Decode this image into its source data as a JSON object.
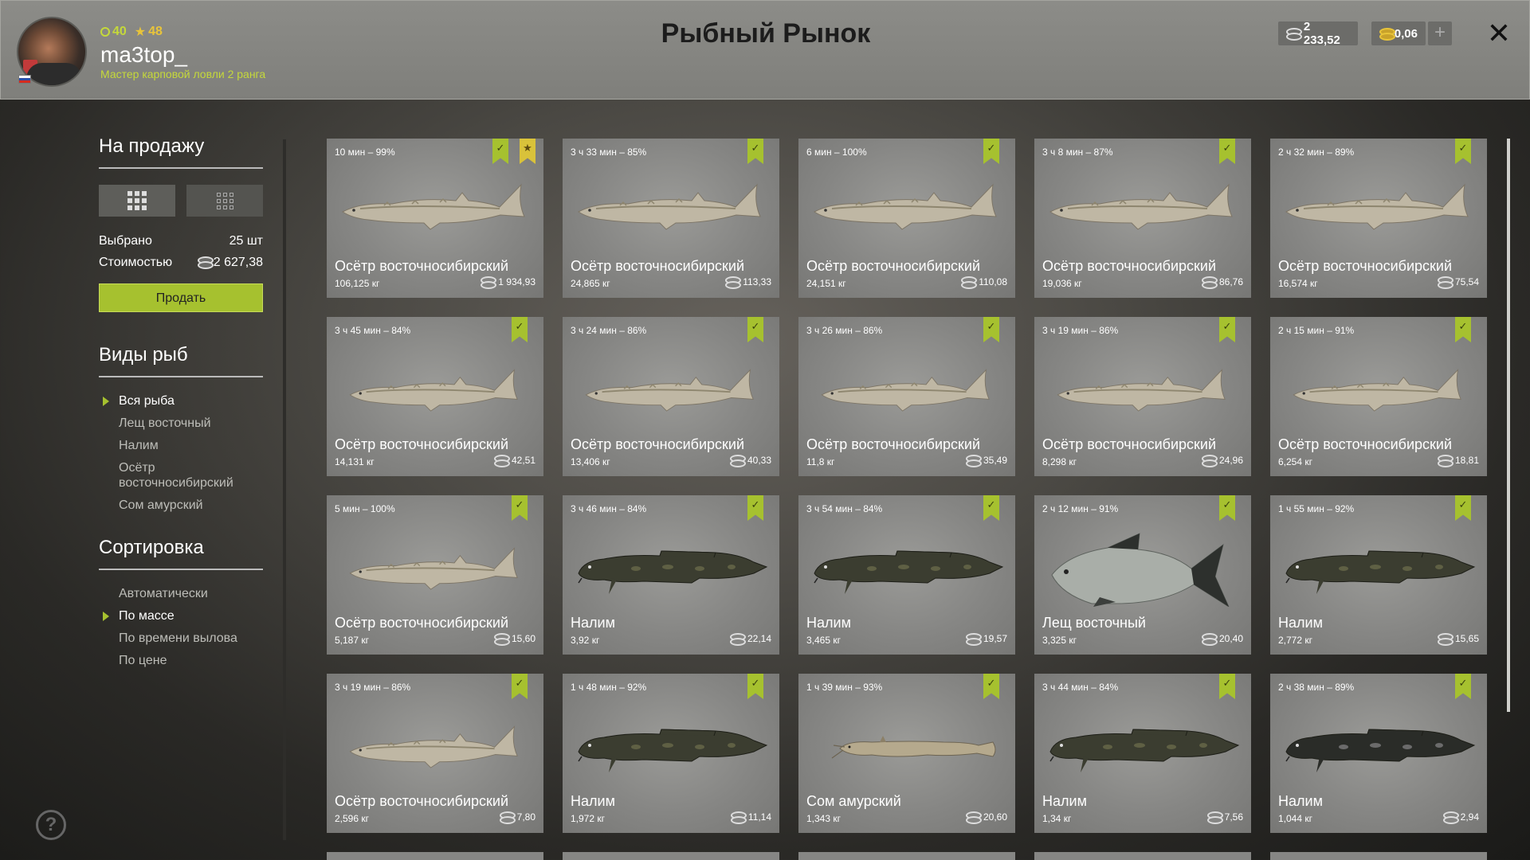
{
  "header": {
    "title": "Рыбный Рынок",
    "username": "ma3top_",
    "rank": "Мастер карповой ловли 2 ранга",
    "level": "40",
    "stars": "48",
    "silver": "2 233,52",
    "gold": "0,06",
    "add_label": "+",
    "close_label": "✕"
  },
  "sidebar": {
    "for_sale_title": "На продажу",
    "selected_label": "Выбрано",
    "selected_value": "25 шт",
    "cost_label": "Стоимостью",
    "cost_value": "2 627,38",
    "sell_label": "Продать",
    "species_title": "Виды рыб",
    "species": [
      {
        "label": "Вся рыба",
        "active": true
      },
      {
        "label": "Лещ восточный",
        "active": false
      },
      {
        "label": "Налим",
        "active": false
      },
      {
        "label": "Осётр восточносибирский",
        "active": false
      },
      {
        "label": "Сом амурский",
        "active": false
      }
    ],
    "sort_title": "Сортировка",
    "sorts": [
      {
        "label": "Автоматически",
        "active": false
      },
      {
        "label": "По массе",
        "active": true
      },
      {
        "label": "По времени вылова",
        "active": false
      },
      {
        "label": "По цене",
        "active": false
      }
    ],
    "help_label": "?"
  },
  "fish_cards": [
    {
      "time": "10 мин – 99%",
      "name": "Осётр восточносибирский",
      "weight": "106,125 кг",
      "price": "1 934,93",
      "type": "sturgeon",
      "starred": true
    },
    {
      "time": "3 ч 33 мин – 85%",
      "name": "Осётр восточносибирский",
      "weight": "24,865 кг",
      "price": "113,33",
      "type": "sturgeon",
      "starred": false
    },
    {
      "time": "6 мин – 100%",
      "name": "Осётр восточносибирский",
      "weight": "24,151 кг",
      "price": "110,08",
      "type": "sturgeon",
      "starred": false
    },
    {
      "time": "3 ч 8 мин – 87%",
      "name": "Осётр восточносибирский",
      "weight": "19,036 кг",
      "price": "86,76",
      "type": "sturgeon",
      "starred": false
    },
    {
      "time": "2 ч 32 мин – 89%",
      "name": "Осётр восточносибирский",
      "weight": "16,574 кг",
      "price": "75,54",
      "type": "sturgeon",
      "starred": false
    },
    {
      "time": "3 ч 45 мин – 84%",
      "name": "Осётр восточносибирский",
      "weight": "14,131 кг",
      "price": "42,51",
      "type": "sturgeon-small",
      "starred": false
    },
    {
      "time": "3 ч 24 мин – 86%",
      "name": "Осётр восточносибирский",
      "weight": "13,406 кг",
      "price": "40,33",
      "type": "sturgeon-small",
      "starred": false
    },
    {
      "time": "3 ч 26 мин – 86%",
      "name": "Осётр восточносибирский",
      "weight": "11,8 кг",
      "price": "35,49",
      "type": "sturgeon-small",
      "starred": false
    },
    {
      "time": "3 ч 19 мин – 86%",
      "name": "Осётр восточносибирский",
      "weight": "8,298 кг",
      "price": "24,96",
      "type": "sturgeon-small",
      "starred": false
    },
    {
      "time": "2 ч 15 мин – 91%",
      "name": "Осётр восточносибирский",
      "weight": "6,254 кг",
      "price": "18,81",
      "type": "sturgeon-small",
      "starred": false
    },
    {
      "time": "5 мин – 100%",
      "name": "Осётр восточносибирский",
      "weight": "5,187 кг",
      "price": "15,60",
      "type": "sturgeon-small",
      "starred": false
    },
    {
      "time": "3 ч 46 мин – 84%",
      "name": "Налим",
      "weight": "3,92 кг",
      "price": "22,14",
      "type": "burbot",
      "starred": false
    },
    {
      "time": "3 ч 54 мин – 84%",
      "name": "Налим",
      "weight": "3,465 кг",
      "price": "19,57",
      "type": "burbot",
      "starred": false
    },
    {
      "time": "2 ч 12 мин – 91%",
      "name": "Лещ восточный",
      "weight": "3,325 кг",
      "price": "20,40",
      "type": "bream",
      "starred": false
    },
    {
      "time": "1 ч 55 мин – 92%",
      "name": "Налим",
      "weight": "2,772 кг",
      "price": "15,65",
      "type": "burbot",
      "starred": false
    },
    {
      "time": "3 ч 19 мин – 86%",
      "name": "Осётр восточносибирский",
      "weight": "2,596 кг",
      "price": "7,80",
      "type": "sturgeon-small",
      "starred": false
    },
    {
      "time": "1 ч 48 мин – 92%",
      "name": "Налим",
      "weight": "1,972 кг",
      "price": "11,14",
      "type": "burbot",
      "starred": false
    },
    {
      "time": "1 ч 39 мин – 93%",
      "name": "Сом амурский",
      "weight": "1,343 кг",
      "price": "20,60",
      "type": "catfish",
      "starred": false
    },
    {
      "time": "3 ч 44 мин – 84%",
      "name": "Налим",
      "weight": "1,34 кг",
      "price": "7,56",
      "type": "burbot",
      "starred": false
    },
    {
      "time": "2 ч 38 мин – 89%",
      "name": "Налим",
      "weight": "1,044 кг",
      "price": "2,94",
      "type": "burbot-dark",
      "starred": false
    }
  ]
}
